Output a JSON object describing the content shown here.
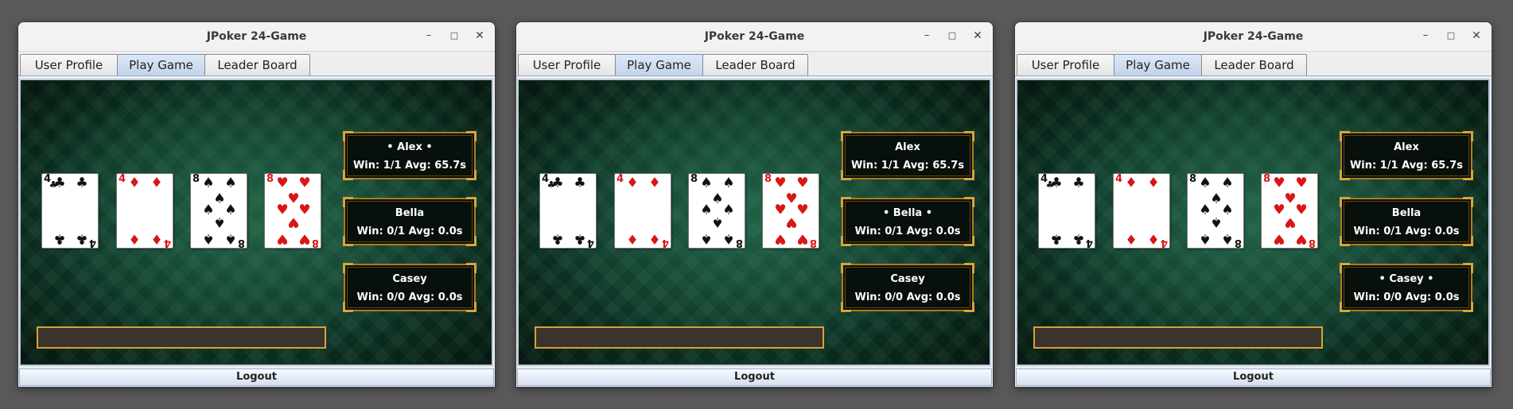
{
  "colors": {
    "desktop": "#595959",
    "table_felt": "#124730",
    "gold_frame": "#b27a1d",
    "answer_bg": "#3b342c",
    "card_red": "#d81616",
    "card_black": "#111111"
  },
  "windows": [
    {
      "title": "JPoker 24-Game",
      "controls": {
        "minimize": "–",
        "maximize": "□",
        "close": "✕"
      },
      "tabs": [
        {
          "label": "User Profile"
        },
        {
          "label": "Play Game"
        },
        {
          "label": "Leader Board"
        }
      ],
      "active_tab": "Play Game",
      "cards": [
        {
          "rank": "4",
          "suit": "♣",
          "color": "black"
        },
        {
          "rank": "4",
          "suit": "♦",
          "color": "red"
        },
        {
          "rank": "8",
          "suit": "♠",
          "color": "black"
        },
        {
          "rank": "8",
          "suit": "♥",
          "color": "red"
        }
      ],
      "players": [
        {
          "name": "• Alex •",
          "stats": "Win: 1/1 Avg: 65.7s"
        },
        {
          "name": "Bella",
          "stats": "Win: 0/1 Avg: 0.0s"
        },
        {
          "name": "Casey",
          "stats": "Win: 0/0 Avg: 0.0s"
        }
      ],
      "answer_value": "",
      "logout_label": "Logout"
    },
    {
      "title": "JPoker 24-Game",
      "controls": {
        "minimize": "–",
        "maximize": "□",
        "close": "✕"
      },
      "tabs": [
        {
          "label": "User Profile"
        },
        {
          "label": "Play Game"
        },
        {
          "label": "Leader Board"
        }
      ],
      "active_tab": "Play Game",
      "cards": [
        {
          "rank": "4",
          "suit": "♣",
          "color": "black"
        },
        {
          "rank": "4",
          "suit": "♦",
          "color": "red"
        },
        {
          "rank": "8",
          "suit": "♠",
          "color": "black"
        },
        {
          "rank": "8",
          "suit": "♥",
          "color": "red"
        }
      ],
      "players": [
        {
          "name": "Alex",
          "stats": "Win: 1/1 Avg: 65.7s"
        },
        {
          "name": "• Bella •",
          "stats": "Win: 0/1 Avg: 0.0s"
        },
        {
          "name": "Casey",
          "stats": "Win: 0/0 Avg: 0.0s"
        }
      ],
      "answer_value": "",
      "logout_label": "Logout"
    },
    {
      "title": "JPoker 24-Game",
      "controls": {
        "minimize": "–",
        "maximize": "□",
        "close": "✕"
      },
      "tabs": [
        {
          "label": "User Profile"
        },
        {
          "label": "Play Game"
        },
        {
          "label": "Leader Board"
        }
      ],
      "active_tab": "Play Game",
      "cards": [
        {
          "rank": "4",
          "suit": "♣",
          "color": "black"
        },
        {
          "rank": "4",
          "suit": "♦",
          "color": "red"
        },
        {
          "rank": "8",
          "suit": "♠",
          "color": "black"
        },
        {
          "rank": "8",
          "suit": "♥",
          "color": "red"
        }
      ],
      "players": [
        {
          "name": "Alex",
          "stats": "Win: 1/1 Avg: 65.7s"
        },
        {
          "name": "Bella",
          "stats": "Win: 0/1 Avg: 0.0s"
        },
        {
          "name": "• Casey •",
          "stats": "Win: 0/0 Avg: 0.0s"
        }
      ],
      "answer_value": "",
      "logout_label": "Logout"
    }
  ]
}
